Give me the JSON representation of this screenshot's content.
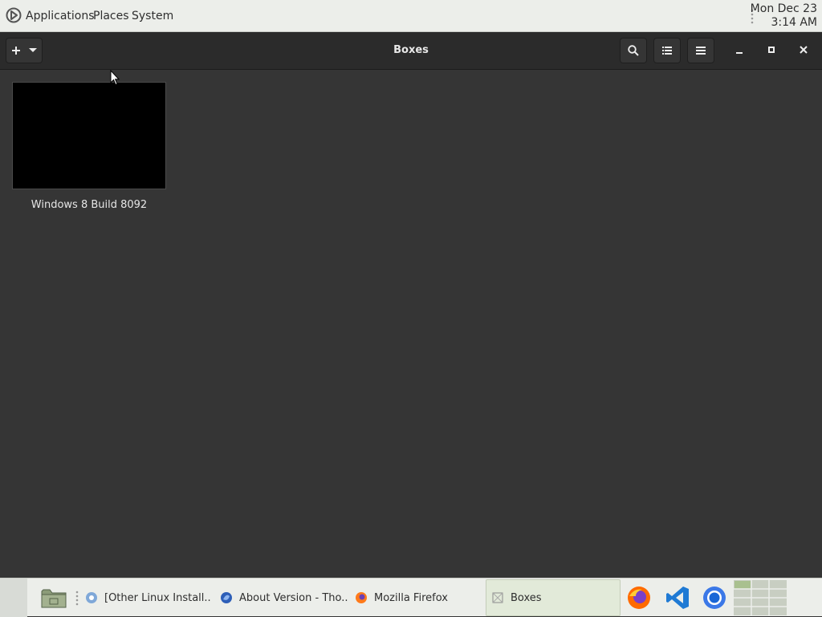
{
  "top_panel": {
    "menus": [
      "Applications",
      "Places",
      "System"
    ],
    "clock": {
      "date": "Mon Dec 23",
      "time": "3:14 AM"
    }
  },
  "header": {
    "title": "Boxes",
    "new_button_icon": "plus-icon",
    "new_button_arrow_icon": "chevron-down-icon",
    "search_icon": "search-icon",
    "list_view_icon": "list-view-icon",
    "menu_icon": "hamburger-menu-icon",
    "minimize_icon": "minimize-icon",
    "maximize_icon": "maximize-icon",
    "close_icon": "close-icon"
  },
  "boxes": [
    {
      "name": "Windows 8 Build 8092"
    }
  ],
  "taskbar": {
    "tasks": [
      {
        "label": "[Other Linux Install...",
        "icon": "chromium-icon"
      },
      {
        "label": "About Version - Tho...",
        "icon": "browser-icon"
      },
      {
        "label": "Mozilla Firefox",
        "icon": "firefox-icon"
      },
      {
        "label": "Boxes",
        "icon": "boxes-icon",
        "active": true
      }
    ],
    "launchers": [
      "firefox-icon",
      "vscode-icon",
      "chrome-icon"
    ]
  },
  "colors": {
    "panel_bg": "#eceeea",
    "headerbar_bg": "#2b2b2b",
    "content_bg": "#353535",
    "active_task_bg": "#e2ead9",
    "mate_green": "#6a7a5a"
  }
}
